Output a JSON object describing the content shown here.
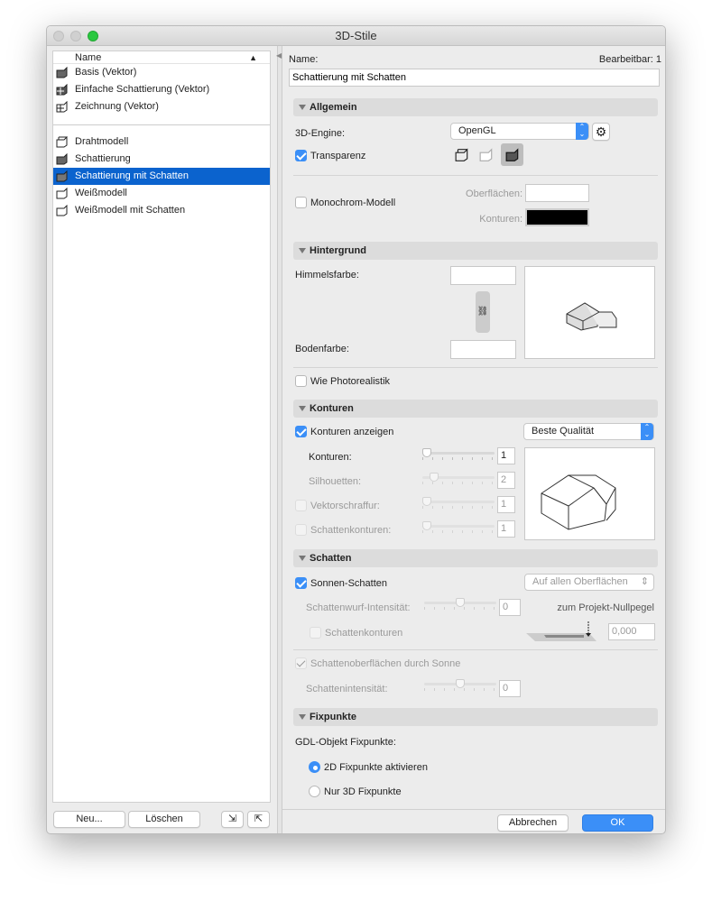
{
  "window": {
    "title": "3D-Stile"
  },
  "list": {
    "column_header": "Name",
    "group1": [
      {
        "label": "Basis (Vektor)"
      },
      {
        "label": "Einfache Schattierung (Vektor)"
      },
      {
        "label": "Zeichnung (Vektor)"
      }
    ],
    "group2": [
      {
        "label": "Drahtmodell"
      },
      {
        "label": "Schattierung"
      },
      {
        "label": "Schattierung mit Schatten",
        "selected": true
      },
      {
        "label": "Weißmodell"
      },
      {
        "label": "Weißmodell mit Schatten"
      }
    ],
    "new_label": "Neu...",
    "delete_label": "Löschen"
  },
  "header": {
    "name_label": "Name:",
    "editable_label": "Bearbeitbar: 1",
    "name_value": "Schattierung mit Schatten"
  },
  "allgemein": {
    "title": "Allgemein",
    "engine_label": "3D-Engine:",
    "engine_value": "OpenGL",
    "transparency_label": "Transparenz",
    "transparency_checked": true,
    "mono_label": "Monochrom-Modell",
    "mono_checked": false,
    "surfaces_label": "Oberflächen:",
    "contours_label": "Konturen:",
    "surface_color": "#ffffff",
    "contour_color": "#000000"
  },
  "hintergrund": {
    "title": "Hintergrund",
    "sky_label": "Himmelsfarbe:",
    "ground_label": "Bodenfarbe:",
    "photo_label": "Wie Photorealistik",
    "photo_checked": false
  },
  "konturen": {
    "title": "Konturen",
    "show_label": "Konturen anzeigen",
    "show_checked": true,
    "quality_value": "Beste Qualität",
    "rows": [
      {
        "label": "Konturen:",
        "value": "1",
        "enabled": true
      },
      {
        "label": "Silhouetten:",
        "value": "2",
        "enabled": false
      },
      {
        "label": "Vektorschraffur:",
        "value": "1",
        "enabled": false
      },
      {
        "label": "Schattenkonturen:",
        "value": "1",
        "enabled": false
      }
    ]
  },
  "schatten": {
    "title": "Schatten",
    "sun_label": "Sonnen-Schatten",
    "sun_checked": true,
    "surfaces_value": "Auf allen Oberflächen",
    "cast_label": "Schattenwurf-Intensität:",
    "cast_value": "0",
    "shadow_contours_label": "Schattenkonturen",
    "level_label": "zum Projekt-Nullpegel",
    "level_value": "0,000",
    "surfaces_by_sun_label": "Schattenoberflächen durch Sonne",
    "intensity_label": "Schattenintensität:",
    "intensity_value": "0"
  },
  "fixpunkte": {
    "title": "Fixpunkte",
    "gdl_label": "GDL-Objekt Fixpunkte:",
    "option_2d": "2D Fixpunkte aktivieren",
    "option_3d": "Nur 3D Fixpunkte",
    "selected": "2d"
  },
  "footer": {
    "cancel_label": "Abbrechen",
    "ok_label": "OK"
  }
}
